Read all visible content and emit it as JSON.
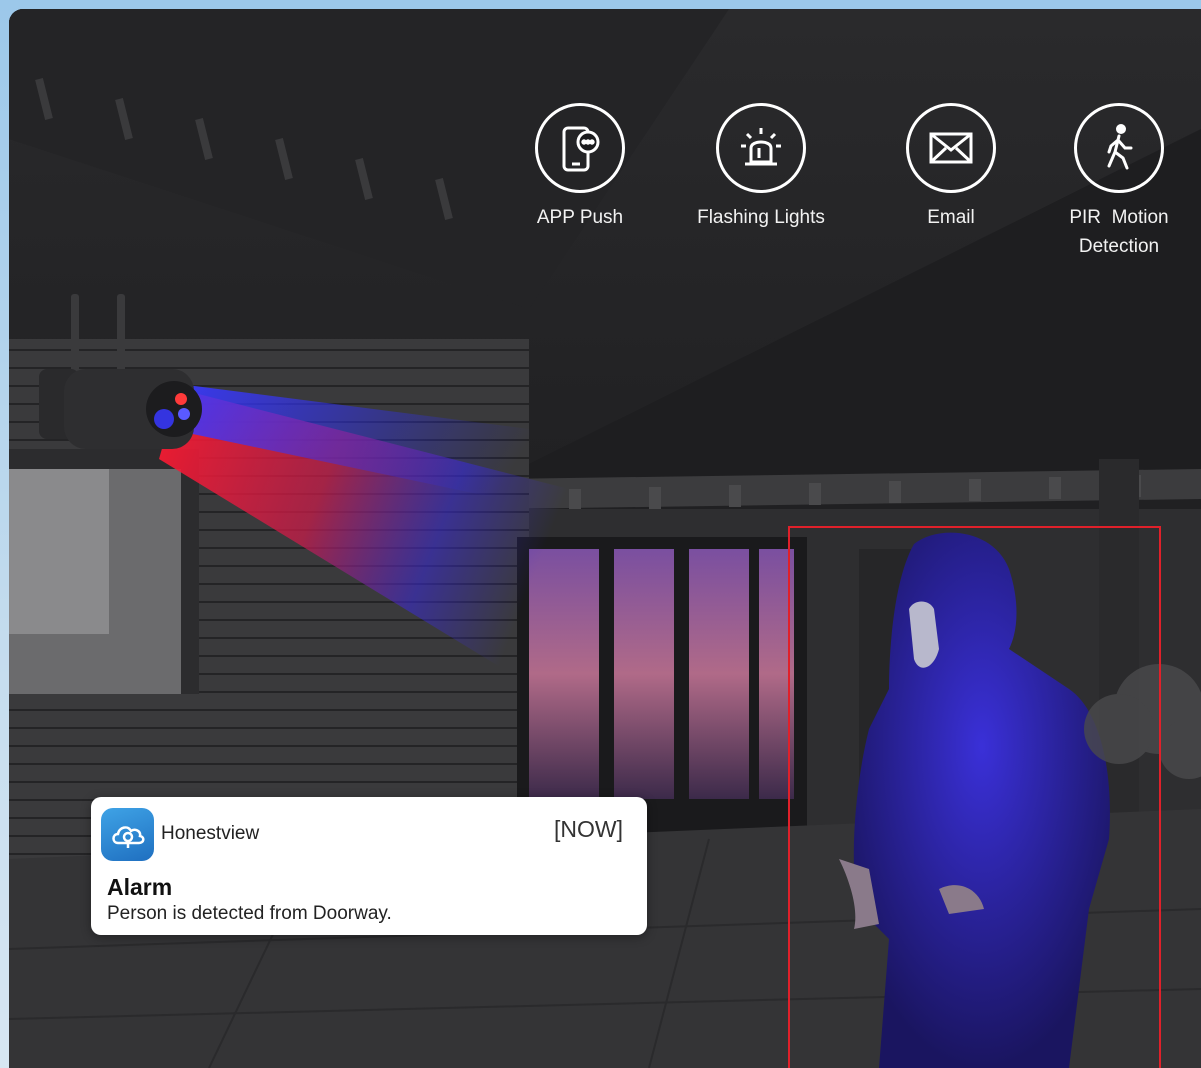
{
  "features": [
    {
      "icon": "phone-chat-icon",
      "label": "APP Push"
    },
    {
      "icon": "alarm-light-icon",
      "label": "Flashing Lights"
    },
    {
      "icon": "envelope-icon",
      "label": "Email"
    },
    {
      "icon": "walking-person-icon",
      "label_line1": "PIR  Motion",
      "label_line2": "Detection"
    }
  ],
  "notification": {
    "app_icon": "cloud-camera-icon",
    "app_name": "Honestview",
    "time": "[NOW]",
    "title": "Alarm",
    "body": "Person is detected from Doorway."
  },
  "colors": {
    "detection_box": "#e0202a",
    "light_red": "#ff1a2e",
    "light_blue": "#2a2aff"
  }
}
